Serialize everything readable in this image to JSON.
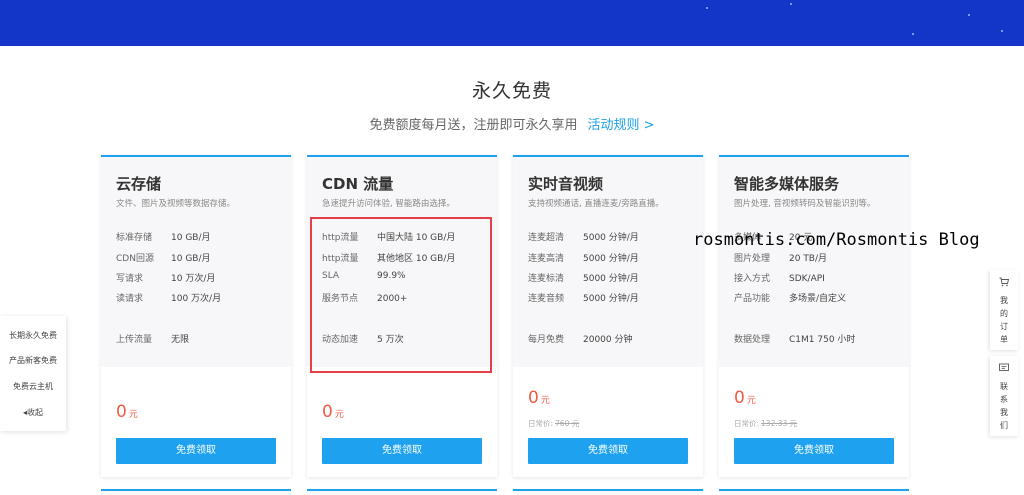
{
  "section": {
    "title": "永久免费",
    "subtitle": "免费额度每月送，注册即可永久享用",
    "rules_link": "活动规则 >"
  },
  "cards": [
    {
      "title": "云存储",
      "desc": "文件、图片及视频等数据存储。",
      "specs": [
        {
          "k": "标准存储",
          "v": "10 GB/月"
        },
        {
          "k": "CDN回源",
          "v": "10 GB/月"
        },
        {
          "k": "写请求",
          "v": "10 万次/月"
        },
        {
          "k": "读请求",
          "v": "100 万次/月"
        }
      ],
      "extra": {
        "k": "上传流量",
        "v": "无限"
      },
      "price": "0",
      "unit": "元",
      "button": "免费领取"
    },
    {
      "title": "CDN 流量",
      "desc": "急速提升访问体验, 智能路由选择。",
      "specs": [
        {
          "k": "http流量",
          "v": "中国大陆 10 GB/月"
        },
        {
          "k": "http流量",
          "v": "其他地区 10 GB/月"
        },
        {
          "k": "SLA",
          "v": "99.9%"
        },
        {
          "k": "服务节点",
          "v": "2000+"
        }
      ],
      "extra": {
        "k": "动态加速",
        "v": "5 万次"
      },
      "price": "0",
      "unit": "元",
      "button": "免费领取"
    },
    {
      "title": "实时音视频",
      "desc": "支持视频通话, 直播连麦/旁路直播。",
      "specs": [
        {
          "k": "连麦超清",
          "v": "5000 分钟/月"
        },
        {
          "k": "连麦高清",
          "v": "5000 分钟/月"
        },
        {
          "k": "连麦标清",
          "v": "5000 分钟/月"
        },
        {
          "k": "连麦音频",
          "v": "5000 分钟/月"
        }
      ],
      "extra": {
        "k": "每月免费",
        "v": "20000 分钟"
      },
      "price": "0",
      "unit": "元",
      "orig_label": "日常价:",
      "orig_price": "760 元",
      "button": "免费领取"
    },
    {
      "title": "智能多媒体服务",
      "desc": "图片处理, 音视频转码及智能识别等。",
      "specs": [
        {
          "k": "多媒体",
          "v": "20 元"
        },
        {
          "k": "图片处理",
          "v": "20 TB/月"
        },
        {
          "k": "接入方式",
          "v": "SDK/API"
        },
        {
          "k": "产品功能",
          "v": "多场景/自定义"
        }
      ],
      "extra": {
        "k": "数据处理",
        "v": "C1M1 750 小时"
      },
      "price": "0",
      "unit": "元",
      "orig_label": "日常价:",
      "orig_price": "132.33 元",
      "button": "免费领取"
    }
  ],
  "left_nav": [
    "长期永久免费",
    "产品新客免费",
    "免费云主机",
    "收起"
  ],
  "right_bar": {
    "orders": "我的订单",
    "contact": "联系我们"
  },
  "watermark": "rosmontis.com/Rosmontis Blog"
}
